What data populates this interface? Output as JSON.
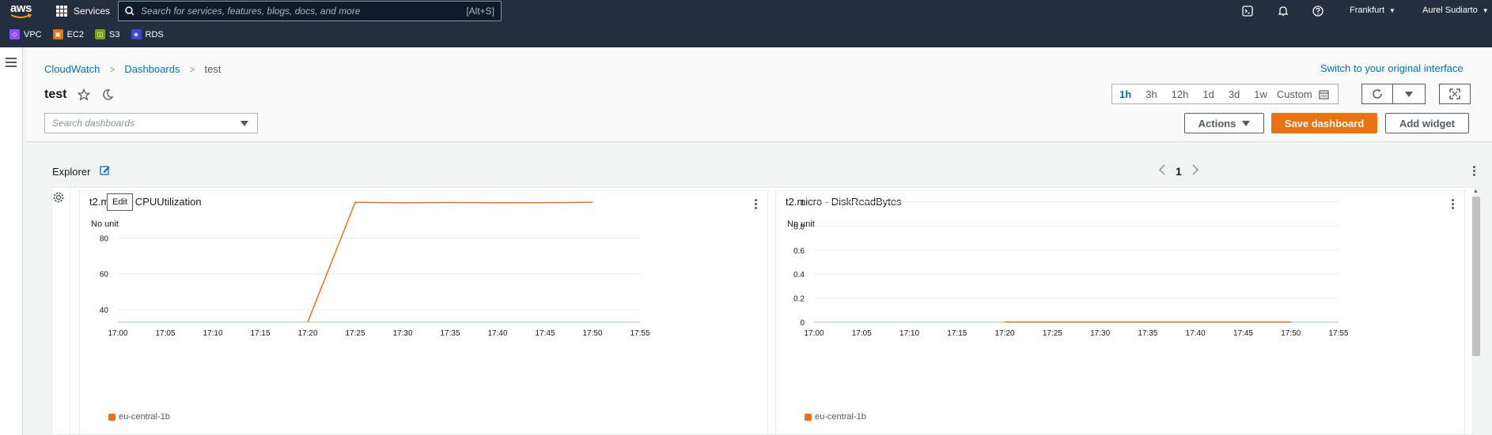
{
  "topnav": {
    "logo": "aws",
    "services_label": "Services",
    "search_placeholder": "Search for services, features, blogs, docs, and more",
    "search_shortcut": "[Alt+S]",
    "region": "Frankfurt",
    "user": "Aurel Sudiarto",
    "favorites": [
      {
        "label": "VPC",
        "color": "#8c4fff",
        "icon": "vpc-icon"
      },
      {
        "label": "EC2",
        "color": "#ed7100",
        "icon": "ec2-icon"
      },
      {
        "label": "S3",
        "color": "#7aa116",
        "icon": "s3-icon"
      },
      {
        "label": "RDS",
        "color": "#3b48cc",
        "icon": "rds-icon"
      }
    ]
  },
  "breadcrumb": {
    "items": [
      "CloudWatch",
      "Dashboards"
    ],
    "current": "test"
  },
  "switch_link": "Switch to your original interface",
  "page_title": "test",
  "time_range": {
    "options": [
      "1h",
      "3h",
      "12h",
      "1d",
      "3d",
      "1w"
    ],
    "active": "1h",
    "custom_label": "Custom"
  },
  "search_dashboards_placeholder": "Search dashboards",
  "buttons": {
    "actions": "Actions",
    "save_dashboard": "Save dashboard",
    "add_widget": "Add widget"
  },
  "explorer": {
    "label": "Explorer",
    "page": "1"
  },
  "tooltip": "Edit",
  "widgets": [
    {
      "title": "t2.micro - CPUUtilization",
      "unit_label": "No unit",
      "legend": "eu-central-1b"
    },
    {
      "title": "t2.micro - DiskReadBytes",
      "unit_label": "No unit",
      "legend": "eu-central-1b"
    }
  ],
  "chart_data": [
    {
      "type": "line",
      "title": "t2.micro - CPUUtilization",
      "ylabel": "No unit",
      "x": [
        "17:00",
        "17:05",
        "17:10",
        "17:15",
        "17:20",
        "17:25",
        "17:30",
        "17:35",
        "17:40",
        "17:45",
        "17:50",
        "17:55"
      ],
      "yticks": [
        40,
        60,
        80
      ],
      "ylim": [
        33,
        100
      ],
      "series": [
        {
          "name": "eu-central-1b",
          "color": "#ec7211",
          "points": [
            [
              "17:20",
              33
            ],
            [
              "17:25",
              99.9
            ],
            [
              "17:30",
              99.6
            ],
            [
              "17:35",
              99.8
            ],
            [
              "17:40",
              99.6
            ],
            [
              "17:45",
              99.7
            ],
            [
              "17:50",
              99.9
            ]
          ]
        }
      ],
      "grid": true,
      "legend_position": "bottom-left"
    },
    {
      "type": "line",
      "title": "t2.micro - DiskReadBytes",
      "ylabel": "No unit",
      "x": [
        "17:00",
        "17:05",
        "17:10",
        "17:15",
        "17:20",
        "17:25",
        "17:30",
        "17:35",
        "17:40",
        "17:45",
        "17:50",
        "17:55"
      ],
      "yticks": [
        "0",
        "0.2",
        "0.4",
        "0.6",
        "0.8",
        "1"
      ],
      "ylim": [
        0,
        1
      ],
      "series": [
        {
          "name": "eu-central-1b",
          "color": "#ec7211",
          "points": [
            [
              "17:20",
              0
            ],
            [
              "17:25",
              0
            ],
            [
              "17:30",
              0
            ],
            [
              "17:35",
              0
            ],
            [
              "17:40",
              0
            ],
            [
              "17:45",
              0
            ],
            [
              "17:50",
              0
            ]
          ]
        }
      ],
      "grid": true,
      "legend_position": "bottom-left"
    }
  ]
}
